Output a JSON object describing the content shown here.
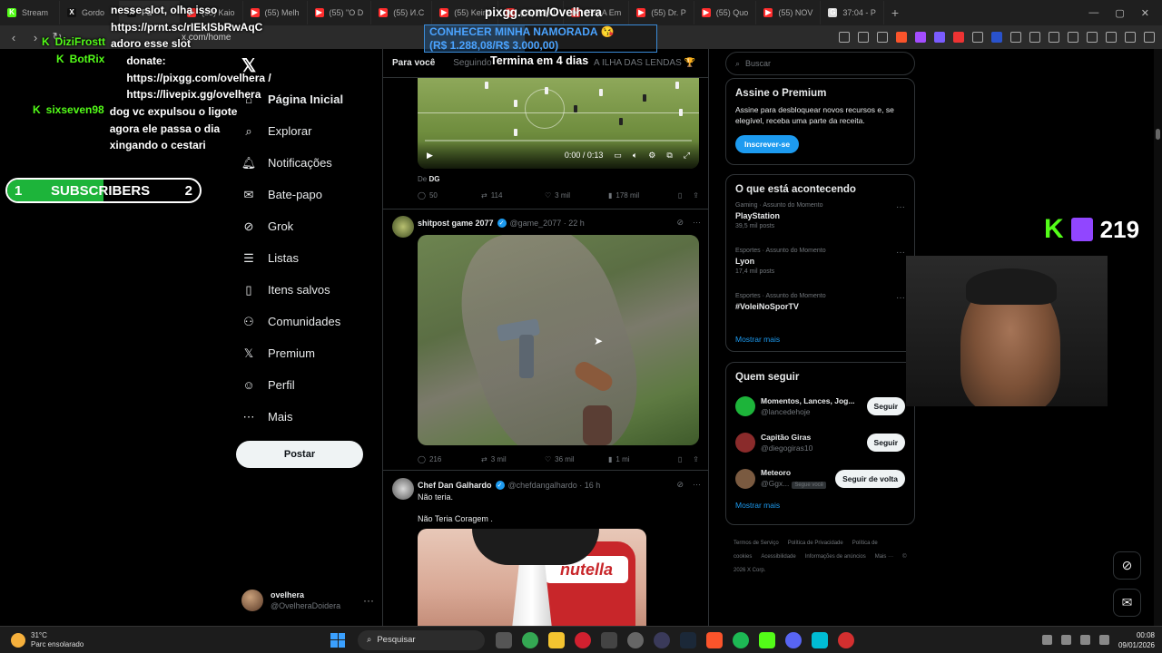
{
  "browser": {
    "tabs": [
      {
        "label": "Stream",
        "color": "#53fc18",
        "letter": "K"
      },
      {
        "label": "Gordo",
        "color": "#111",
        "letter": "X"
      },
      {
        "label": "Pa",
        "color": "#111",
        "letter": "X"
      },
      {
        "label": "(55) Kaio",
        "color": "#ff2d2d",
        "letter": "▶"
      },
      {
        "label": "(55) Melh",
        "color": "#ff2d2d",
        "letter": "▶"
      },
      {
        "label": "(55) \"O D",
        "color": "#ff2d2d",
        "letter": "▶"
      },
      {
        "label": "(55) И.С",
        "color": "#ff2d2d",
        "letter": "▶"
      },
      {
        "label": "(55) Keirn",
        "color": "#ff2d2d",
        "letter": "▶"
      },
      {
        "label": "(55) RAFI",
        "color": "#ff2d2d",
        "letter": "▶"
      },
      {
        "label": "(55) A Em",
        "color": "#ff2d2d",
        "letter": "▶"
      },
      {
        "label": "(55) Dr. P",
        "color": "#ff2d2d",
        "letter": "▶"
      },
      {
        "label": "(55) Quo",
        "color": "#ff2d2d",
        "letter": "▶"
      },
      {
        "label": "(55) NOV",
        "color": "#ff2d2d",
        "letter": "▶"
      },
      {
        "label": "37:04 - P",
        "color": "#dddddd",
        "letter": "G"
      }
    ],
    "url": "x.com/home"
  },
  "overlay": {
    "pix_url": "pixgg.com/Ovelhera",
    "goal_title": "CONHECER MINHA NAMORADA 😘",
    "goal_amount": "(R$ 1.288,08/R$ 3.000,00)",
    "goal_progress": 0.43,
    "goal_deadline": "Termina em 4 dias",
    "chat": [
      {
        "user": "",
        "msg": "nesse slot, olha isso https://prnt.sc/rIEkISbRwAqC adoro esse slot"
      },
      {
        "user": "DiziFrostt",
        "msg": ""
      },
      {
        "user": "BotRix",
        "msg": "donate: https://pixgg.com/ovelhera / https://livepix.gg/ovelhera"
      },
      {
        "user": "sixseven98",
        "msg": "dog vc expulsou o ligote agora ele passa o dia xingando o cestari"
      }
    ],
    "subs": {
      "current": "1",
      "label": "SUBSCRIBERS",
      "target": "2",
      "progress": 0.5
    },
    "viewers": "219"
  },
  "sidebar": {
    "items": [
      {
        "label": "Página Inicial",
        "icon": "home-icon"
      },
      {
        "label": "Explorar",
        "icon": "search-icon"
      },
      {
        "label": "Notificações",
        "icon": "bell-icon"
      },
      {
        "label": "Bate-papo",
        "icon": "mail-icon"
      },
      {
        "label": "Grok",
        "icon": "grok-icon"
      },
      {
        "label": "Listas",
        "icon": "list-icon"
      },
      {
        "label": "Itens salvos",
        "icon": "bookmark-icon"
      },
      {
        "label": "Comunidades",
        "icon": "people-icon"
      },
      {
        "label": "Premium",
        "icon": "x-icon"
      },
      {
        "label": "Perfil",
        "icon": "person-icon"
      },
      {
        "label": "Mais",
        "icon": "more-icon"
      }
    ],
    "post_label": "Postar",
    "account_name": "ovelhera",
    "account_handle": "@OvelheraDoidera"
  },
  "feed": {
    "tabs": [
      "Para você",
      "Seguindo",
      "A ILHA DAS LENDAS 🏆"
    ],
    "tweet1": {
      "video_time": "0:00 / 0:13",
      "source_prefix": "De",
      "source_name": "DG",
      "replies": "50",
      "reposts": "114",
      "likes": "3 mil",
      "views": "178 mil"
    },
    "tweet2": {
      "name": "shitpost game 2077",
      "handle": "@game_2077 · 22 h",
      "replies": "216",
      "reposts": "3 mil",
      "likes": "36 mil",
      "views": "1 mi"
    },
    "tweet3": {
      "name": "Chef Dan Galhardo",
      "handle": "@chefdangalhardo · 16 h",
      "text1": "Não teria.",
      "text2": "Não Teria Coragem .",
      "jar_label": "nutella"
    }
  },
  "right": {
    "search_placeholder": "Buscar",
    "premium": {
      "title": "Assine o Premium",
      "text": "Assine para desbloquear novos recursos e, se elegível, receba uma parte da receita.",
      "button": "Inscrever-se"
    },
    "trending": {
      "title": "O que está acontecendo",
      "items": [
        {
          "meta": "Gaming · Assunto do Momento",
          "name": "PlayStation",
          "count": "39,5 mil posts"
        },
        {
          "meta": "Esportes · Assunto do Momento",
          "name": "Lyon",
          "count": "17,4 mil posts"
        },
        {
          "meta": "Esportes · Assunto do Momento",
          "name": "#VoleiNoSporTV",
          "count": ""
        }
      ],
      "more": "Mostrar mais"
    },
    "who_to_follow": {
      "title": "Quem seguir",
      "items": [
        {
          "name": "Momentos, Lances, Jog...",
          "handle": "@lancedehoje",
          "badge": "",
          "button": "Seguir",
          "color": "#1db43a"
        },
        {
          "name": "Capitão Giras",
          "handle": "@diegogiras10",
          "badge": "",
          "button": "Seguir",
          "color": "#8a2b2b"
        },
        {
          "name": "Meteoro",
          "handle": "@Ggx...",
          "badge": "Segue você",
          "button": "Seguir de volta",
          "color": "#7a5a40"
        }
      ],
      "more": "Mostrar mais"
    },
    "footer": [
      "Termos de Serviço",
      "Política de Privacidade",
      "Política de cookies",
      "Acessibilidade",
      "Informações de anúncios",
      "Mais ···",
      "© 2026 X Corp."
    ]
  },
  "taskbar": {
    "temp": "31°C",
    "weather": "Parc ensolarado",
    "search": "Pesquisar",
    "time": "00:08",
    "date": "09/01/2026"
  }
}
